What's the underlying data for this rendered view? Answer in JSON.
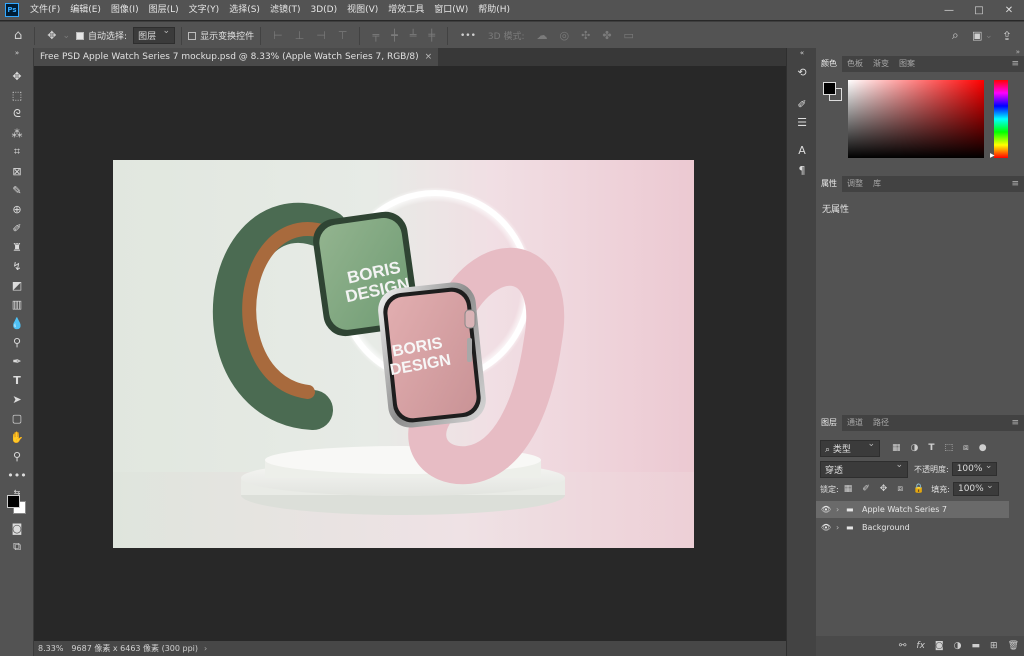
{
  "menu": {
    "items": [
      "文件(F)",
      "编辑(E)",
      "图像(I)",
      "图层(L)",
      "文字(Y)",
      "选择(S)",
      "滤镜(T)",
      "3D(D)",
      "视图(V)",
      "增效工具",
      "窗口(W)",
      "帮助(H)"
    ]
  },
  "window_controls": {
    "minimize": "—",
    "restore": "□",
    "close": "✕"
  },
  "options": {
    "auto_select_label": "自动选择:",
    "auto_select_target": "图层",
    "show_transform_label": "显示变换控件",
    "mode_3d_label": "3D 模式:",
    "more": "•••"
  },
  "document": {
    "tab_title": "Free PSD Apple Watch Series 7 mockup.psd @ 8.33% (Apple Watch Series 7, RGB/8)",
    "close": "×",
    "zoom": "8.33%",
    "size_info": "9687 像素 x 6463 像素 (300 ppi)"
  },
  "artwork": {
    "green_watch_text_1": "BORIS",
    "green_watch_text_2": "DESIGN",
    "pink_watch_text_1": "BORIS",
    "pink_watch_text_2": "DESIGN"
  },
  "panels": {
    "color": {
      "tabs": [
        "颜色",
        "色板",
        "渐变",
        "图案"
      ],
      "foreground": "#000000",
      "background": "#ffffff"
    },
    "properties": {
      "tabs": [
        "属性",
        "调整",
        "库"
      ],
      "empty_label": "无属性"
    },
    "layers": {
      "tabs": [
        "图层",
        "通道",
        "路径"
      ],
      "filter_kind": "类型",
      "blend_mode": "穿透",
      "opacity_label": "不透明度:",
      "opacity": "100%",
      "lock_label": "锁定:",
      "fill_label": "填充:",
      "fill": "100%",
      "items": [
        {
          "name": "Apple Watch Series 7",
          "selected": true
        },
        {
          "name": "Background",
          "selected": false
        }
      ]
    }
  },
  "colors": {
    "accent": "#31a8ff",
    "ui_dark": "#282828",
    "ui_mid": "#535353"
  }
}
